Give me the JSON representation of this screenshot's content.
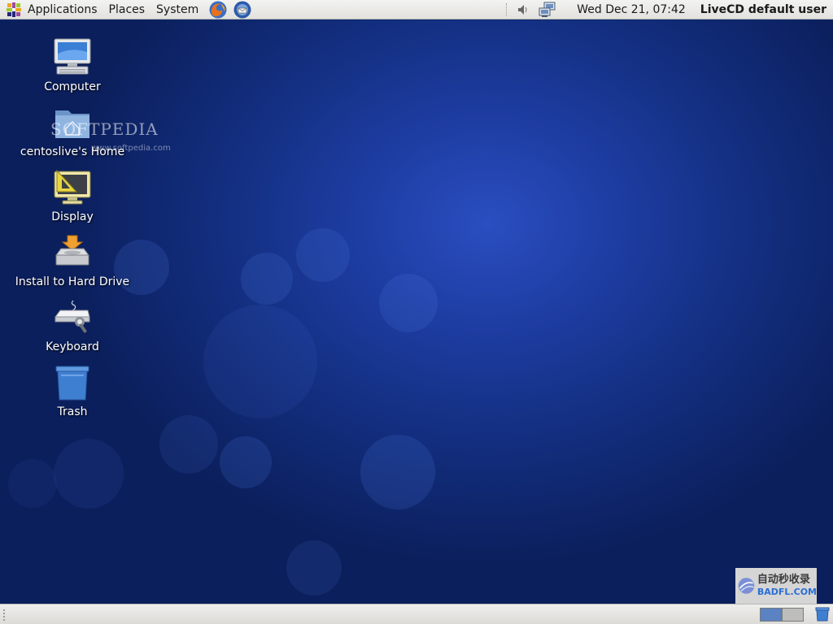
{
  "top_panel": {
    "menus": [
      "Applications",
      "Places",
      "System"
    ],
    "launchers": [
      "firefox-icon",
      "thunderbird-icon"
    ],
    "tray_icons": [
      "volume-icon",
      "network-icon"
    ],
    "clock": "Wed Dec 21, 07:42",
    "user": "LiveCD default user"
  },
  "desktop": {
    "icons": [
      {
        "label": "Computer",
        "icon": "computer-icon"
      },
      {
        "label": "centoslive's Home",
        "icon": "home-folder-icon"
      },
      {
        "label": "Display",
        "icon": "display-icon"
      },
      {
        "label": "Install to Hard Drive",
        "icon": "install-drive-icon"
      },
      {
        "label": "Keyboard",
        "icon": "keyboard-icon"
      },
      {
        "label": "Trash",
        "icon": "trash-icon"
      }
    ],
    "watermarks": {
      "softpedia": "SOFTPEDIA",
      "softpedia_url": "www.softpedia.com",
      "badfl_cn": "自动秒收录",
      "badfl_en": "BADFL.COM"
    },
    "background_color": "#1e3da3"
  },
  "bottom_panel": {
    "workspaces": [
      {
        "active": true
      },
      {
        "active": false
      }
    ],
    "active_color": "#5b82c3"
  }
}
